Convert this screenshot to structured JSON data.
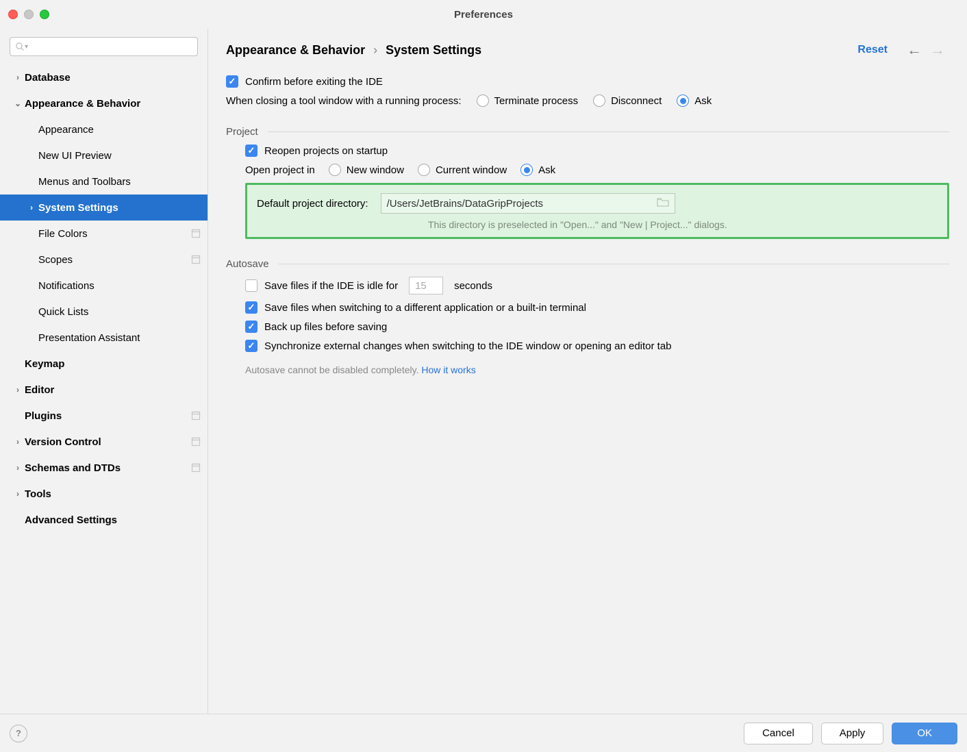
{
  "window": {
    "title": "Preferences"
  },
  "sidebar": {
    "search_placeholder": "",
    "items": [
      {
        "label": "Database",
        "bold": true,
        "arrow": "right",
        "level": 0
      },
      {
        "label": "Appearance & Behavior",
        "bold": true,
        "arrow": "down",
        "level": 0
      },
      {
        "label": "Appearance",
        "bold": false,
        "arrow": "none",
        "level": 1
      },
      {
        "label": "New UI Preview",
        "bold": false,
        "arrow": "none",
        "level": 1
      },
      {
        "label": "Menus and Toolbars",
        "bold": false,
        "arrow": "none",
        "level": 1
      },
      {
        "label": "System Settings",
        "bold": true,
        "arrow": "right",
        "level": 1,
        "selected": true
      },
      {
        "label": "File Colors",
        "bold": false,
        "arrow": "none",
        "level": 1,
        "endicon": true
      },
      {
        "label": "Scopes",
        "bold": false,
        "arrow": "none",
        "level": 1,
        "endicon": true
      },
      {
        "label": "Notifications",
        "bold": false,
        "arrow": "none",
        "level": 1
      },
      {
        "label": "Quick Lists",
        "bold": false,
        "arrow": "none",
        "level": 1
      },
      {
        "label": "Presentation Assistant",
        "bold": false,
        "arrow": "none",
        "level": 1
      },
      {
        "label": "Keymap",
        "bold": true,
        "arrow": "none",
        "level": 0
      },
      {
        "label": "Editor",
        "bold": true,
        "arrow": "right",
        "level": 0
      },
      {
        "label": "Plugins",
        "bold": true,
        "arrow": "none",
        "level": 0,
        "endicon": true
      },
      {
        "label": "Version Control",
        "bold": true,
        "arrow": "right",
        "level": 0,
        "endicon": true
      },
      {
        "label": "Schemas and DTDs",
        "bold": true,
        "arrow": "right",
        "level": 0,
        "endicon": true
      },
      {
        "label": "Tools",
        "bold": true,
        "arrow": "right",
        "level": 0
      },
      {
        "label": "Advanced Settings",
        "bold": true,
        "arrow": "none",
        "level": 0
      }
    ]
  },
  "header": {
    "crumb1": "Appearance & Behavior",
    "sep": "›",
    "crumb2": "System Settings",
    "reset": "Reset"
  },
  "general": {
    "confirm_exit": "Confirm before exiting the IDE",
    "close_tool_label": "When closing a tool window with a running process:",
    "opt_terminate": "Terminate process",
    "opt_disconnect": "Disconnect",
    "opt_ask": "Ask"
  },
  "project": {
    "title": "Project",
    "reopen": "Reopen projects on startup",
    "open_in_label": "Open project in",
    "opt_new_window": "New window",
    "opt_current_window": "Current window",
    "opt_ask": "Ask",
    "dir_label": "Default project directory:",
    "dir_value": "/Users/JetBrains/DataGripProjects",
    "dir_hint": "This directory is preselected in \"Open...\" and \"New | Project...\" dialogs."
  },
  "autosave": {
    "title": "Autosave",
    "idle_prefix": "Save files if the IDE is idle for",
    "idle_value": "15",
    "idle_suffix": "seconds",
    "switch": "Save files when switching to a different application or a built-in terminal",
    "backup": "Back up files before saving",
    "sync": "Synchronize external changes when switching to the IDE window or opening an editor tab",
    "note_prefix": "Autosave cannot be disabled completely. ",
    "note_link": "How it works"
  },
  "footer": {
    "cancel": "Cancel",
    "apply": "Apply",
    "ok": "OK"
  }
}
